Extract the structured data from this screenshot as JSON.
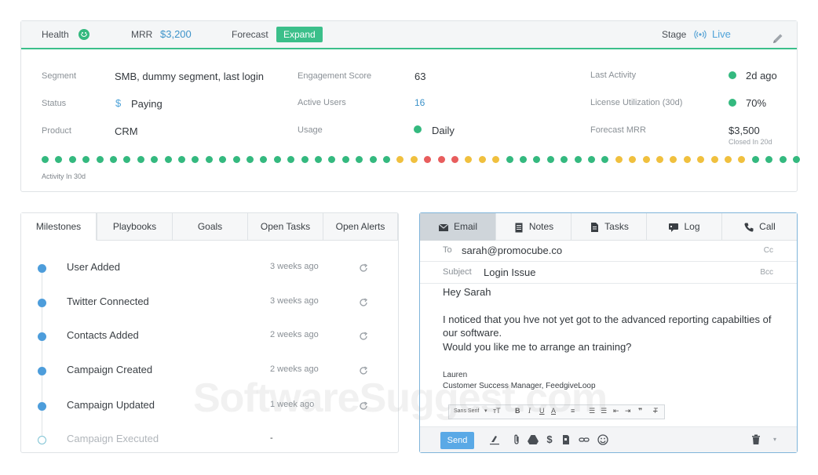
{
  "top_bar": {
    "health_label": "Health",
    "mrr_label": "MRR",
    "mrr_value": "$3,200",
    "forecast_label": "Forecast",
    "expand_label": "Expand",
    "stage_label": "Stage",
    "stage_value": "Live"
  },
  "fields": {
    "segment_label": "Segment",
    "segment_value": "SMB, dummy segment, last login",
    "status_label": "Status",
    "status_symbol": "$",
    "status_value": "Paying",
    "product_label": "Product",
    "product_value": "CRM",
    "engagement_label": "Engagement Score",
    "engagement_value": "63",
    "active_users_label": "Active Users",
    "active_users_value": "16",
    "usage_label": "Usage",
    "usage_value": "Daily",
    "last_activity_label": "Last Activity",
    "last_activity_value": "2d ago",
    "license_label": "License Utilization (30d)",
    "license_value": "70%",
    "forecast_mrr_label": "Forecast MRR",
    "forecast_mrr_value": "$3,500",
    "forecast_mrr_note": "Closed In 20d"
  },
  "activity": {
    "label": "Activity In 30d",
    "levels": [
      "g",
      "g",
      "g",
      "g",
      "g",
      "g",
      "g",
      "g",
      "g",
      "g",
      "g",
      "g",
      "g",
      "g",
      "g",
      "g",
      "g",
      "g",
      "g",
      "g",
      "g",
      "g",
      "g",
      "g",
      "g",
      "g",
      "y",
      "y",
      "r",
      "r",
      "r",
      "y",
      "y",
      "y",
      "g",
      "g",
      "g",
      "g",
      "g",
      "g",
      "g",
      "g",
      "y",
      "y",
      "y",
      "y",
      "y",
      "y",
      "y",
      "y",
      "y",
      "y",
      "g",
      "g",
      "g",
      "g"
    ]
  },
  "colors": {
    "green": "#34b97f",
    "yellow": "#f0c03e",
    "red": "#e85d5d",
    "accent": "#3bbf8a",
    "blue": "#4d9ddb"
  },
  "milestone_tabs": [
    "Milestones",
    "Playbooks",
    "Goals",
    "Open Tasks",
    "Open Alerts"
  ],
  "milestones": [
    {
      "name": "User Added",
      "time": "3 weeks ago",
      "done": true
    },
    {
      "name": "Twitter Connected",
      "time": "3 weeks ago",
      "done": true
    },
    {
      "name": "Contacts Added",
      "time": "2 weeks ago",
      "done": true
    },
    {
      "name": "Campaign Created",
      "time": "2 weeks ago",
      "done": true
    },
    {
      "name": "Campaign Updated",
      "time": "1 week ago",
      "done": true
    },
    {
      "name": "Campaign Executed",
      "time": "-",
      "done": false
    }
  ],
  "composer": {
    "tabs": [
      "Email",
      "Notes",
      "Tasks",
      "Log",
      "Call"
    ],
    "to_label": "To",
    "to_value": "sarah@promocube.co",
    "cc_label": "Cc",
    "subject_label": "Subject",
    "subject_value": "Login Issue",
    "bcc_label": "Bcc",
    "body_line1": "Hey Sarah",
    "body_line2": "I noticed that you hve not yet got to the advanced reporting capabilties of",
    "body_line3": "our software.",
    "body_line4": "Would you like me to arrange an training?",
    "sig_name": "Lauren",
    "sig_title": "Customer Success Manager, FeedgiveLoop",
    "font_select": "Sans Serif",
    "send_label": "Send"
  },
  "watermark": "SoftwareSuggest.com"
}
